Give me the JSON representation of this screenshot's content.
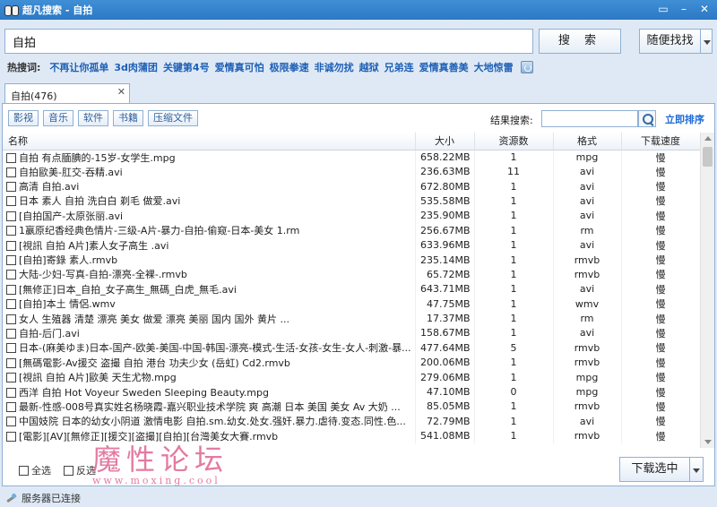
{
  "window": {
    "title": "超凡搜索 - 自拍"
  },
  "search": {
    "value": "自拍",
    "button": "搜 索",
    "random_button": "随便找找"
  },
  "hot": {
    "label": "热搜词:",
    "items": [
      "不再让你孤单",
      "3d肉蒲团",
      "关键第4号",
      "爱情真可怕",
      "极限拳速",
      "非诚勿扰",
      "越狱",
      "兄弟连",
      "爱情真善美",
      "大地惊雷"
    ]
  },
  "tab": {
    "label": "自拍(476)",
    "close": "✕"
  },
  "filters": [
    "影视",
    "音乐",
    "软件",
    "书籍",
    "压缩文件"
  ],
  "result_search": {
    "label": "结果搜索:",
    "sort_link": "立即排序"
  },
  "table": {
    "headers": [
      "名称",
      "大小",
      "资源数",
      "格式",
      "下载速度"
    ],
    "rows": [
      {
        "name": "自拍 有点腼腆的-15岁-女学生.mpg",
        "size": "658.22MB",
        "count": "1",
        "format": "mpg",
        "speed": "慢"
      },
      {
        "name": "自拍歐美-肛交-吞精.avi",
        "size": "236.63MB",
        "count": "11",
        "format": "avi",
        "speed": "慢"
      },
      {
        "name": "高清 自拍.avi",
        "size": "672.80MB",
        "count": "1",
        "format": "avi",
        "speed": "慢"
      },
      {
        "name": "日本 素人 自拍 洗白白 剃毛 做爱.avi",
        "size": "535.58MB",
        "count": "1",
        "format": "avi",
        "speed": "慢"
      },
      {
        "name": "[自拍国产-太原张丽.avi",
        "size": "235.90MB",
        "count": "1",
        "format": "avi",
        "speed": "慢"
      },
      {
        "name": "1嬴原纪香经典色情片-三级-A片-暴力-自拍-偷窥-日本-美女 1.rm",
        "size": "256.67MB",
        "count": "1",
        "format": "rm",
        "speed": "慢"
      },
      {
        "name": "[視訊 自拍 A片]素人女子高生 .avi",
        "size": "633.96MB",
        "count": "1",
        "format": "avi",
        "speed": "慢"
      },
      {
        "name": "[自拍]寄錄 素人.rmvb",
        "size": "235.14MB",
        "count": "1",
        "format": "rmvb",
        "speed": "慢"
      },
      {
        "name": "大陆-少妇-写真-自拍-漂亮-全裸-.rmvb",
        "size": "65.72MB",
        "count": "1",
        "format": "rmvb",
        "speed": "慢"
      },
      {
        "name": "[無修正]日本_自拍_女子高生_無碼_白虎_無毛.avi",
        "size": "643.71MB",
        "count": "1",
        "format": "avi",
        "speed": "慢"
      },
      {
        "name": "[自拍]本土 情侶.wmv",
        "size": "47.75MB",
        "count": "1",
        "format": "wmv",
        "speed": "慢"
      },
      {
        "name": "女人 生殖器 清楚                              漂亮 美女 做爱 漂亮 美丽 国内 国外 黄片 ...",
        "size": "17.37MB",
        "count": "1",
        "format": "rm",
        "speed": "慢"
      },
      {
        "name": "自拍-后门.avi",
        "size": "158.67MB",
        "count": "1",
        "format": "avi",
        "speed": "慢"
      },
      {
        "name": "日本-(麻美ゆま)日本-国产-欧美-美国-中国-韩国-漂亮-模式-生活-女孩-女生-女人-刺激-暴...",
        "size": "477.64MB",
        "count": "5",
        "format": "rmvb",
        "speed": "慢"
      },
      {
        "name": "[無碼電影-Av援交 盗撮 自拍 港台 功夫少女 (岳虹) Cd2.rmvb",
        "size": "200.06MB",
        "count": "1",
        "format": "rmvb",
        "speed": "慢"
      },
      {
        "name": "[視訊 自拍 A片]歐美 天生尤物.mpg",
        "size": "279.06MB",
        "count": "1",
        "format": "mpg",
        "speed": "慢"
      },
      {
        "name": "西洋 自拍 Hot Voyeur Sweden Sleeping Beauty.mpg",
        "size": "47.10MB",
        "count": "0",
        "format": "mpg",
        "speed": "慢"
      },
      {
        "name": "最新-性感-008号真实姓名杨晓霞-嘉兴职业技术学院 爽 高潮 日本 美国 美女 Av 大奶 ...",
        "size": "85.05MB",
        "count": "1",
        "format": "rmvb",
        "speed": "慢"
      },
      {
        "name": "中国妓院 日本的幼女小阴道 激情电影 自拍.sm.幼女.处女.强奸.暴力.虐待.变态.同性.色...",
        "size": "72.79MB",
        "count": "1",
        "format": "avi",
        "speed": "慢"
      },
      {
        "name": "[電影][AV][無修正][援交][盗撮][自拍][台灣美女大賽.rmvb",
        "size": "541.08MB",
        "count": "1",
        "format": "rmvb",
        "speed": "慢"
      }
    ]
  },
  "bottom": {
    "select_all": "全选",
    "invert": "反选",
    "download_button": "下载选中"
  },
  "watermark": {
    "title": "魔性论坛",
    "url": "www.moxing.cool"
  },
  "status": {
    "text": "服务器已连接"
  }
}
